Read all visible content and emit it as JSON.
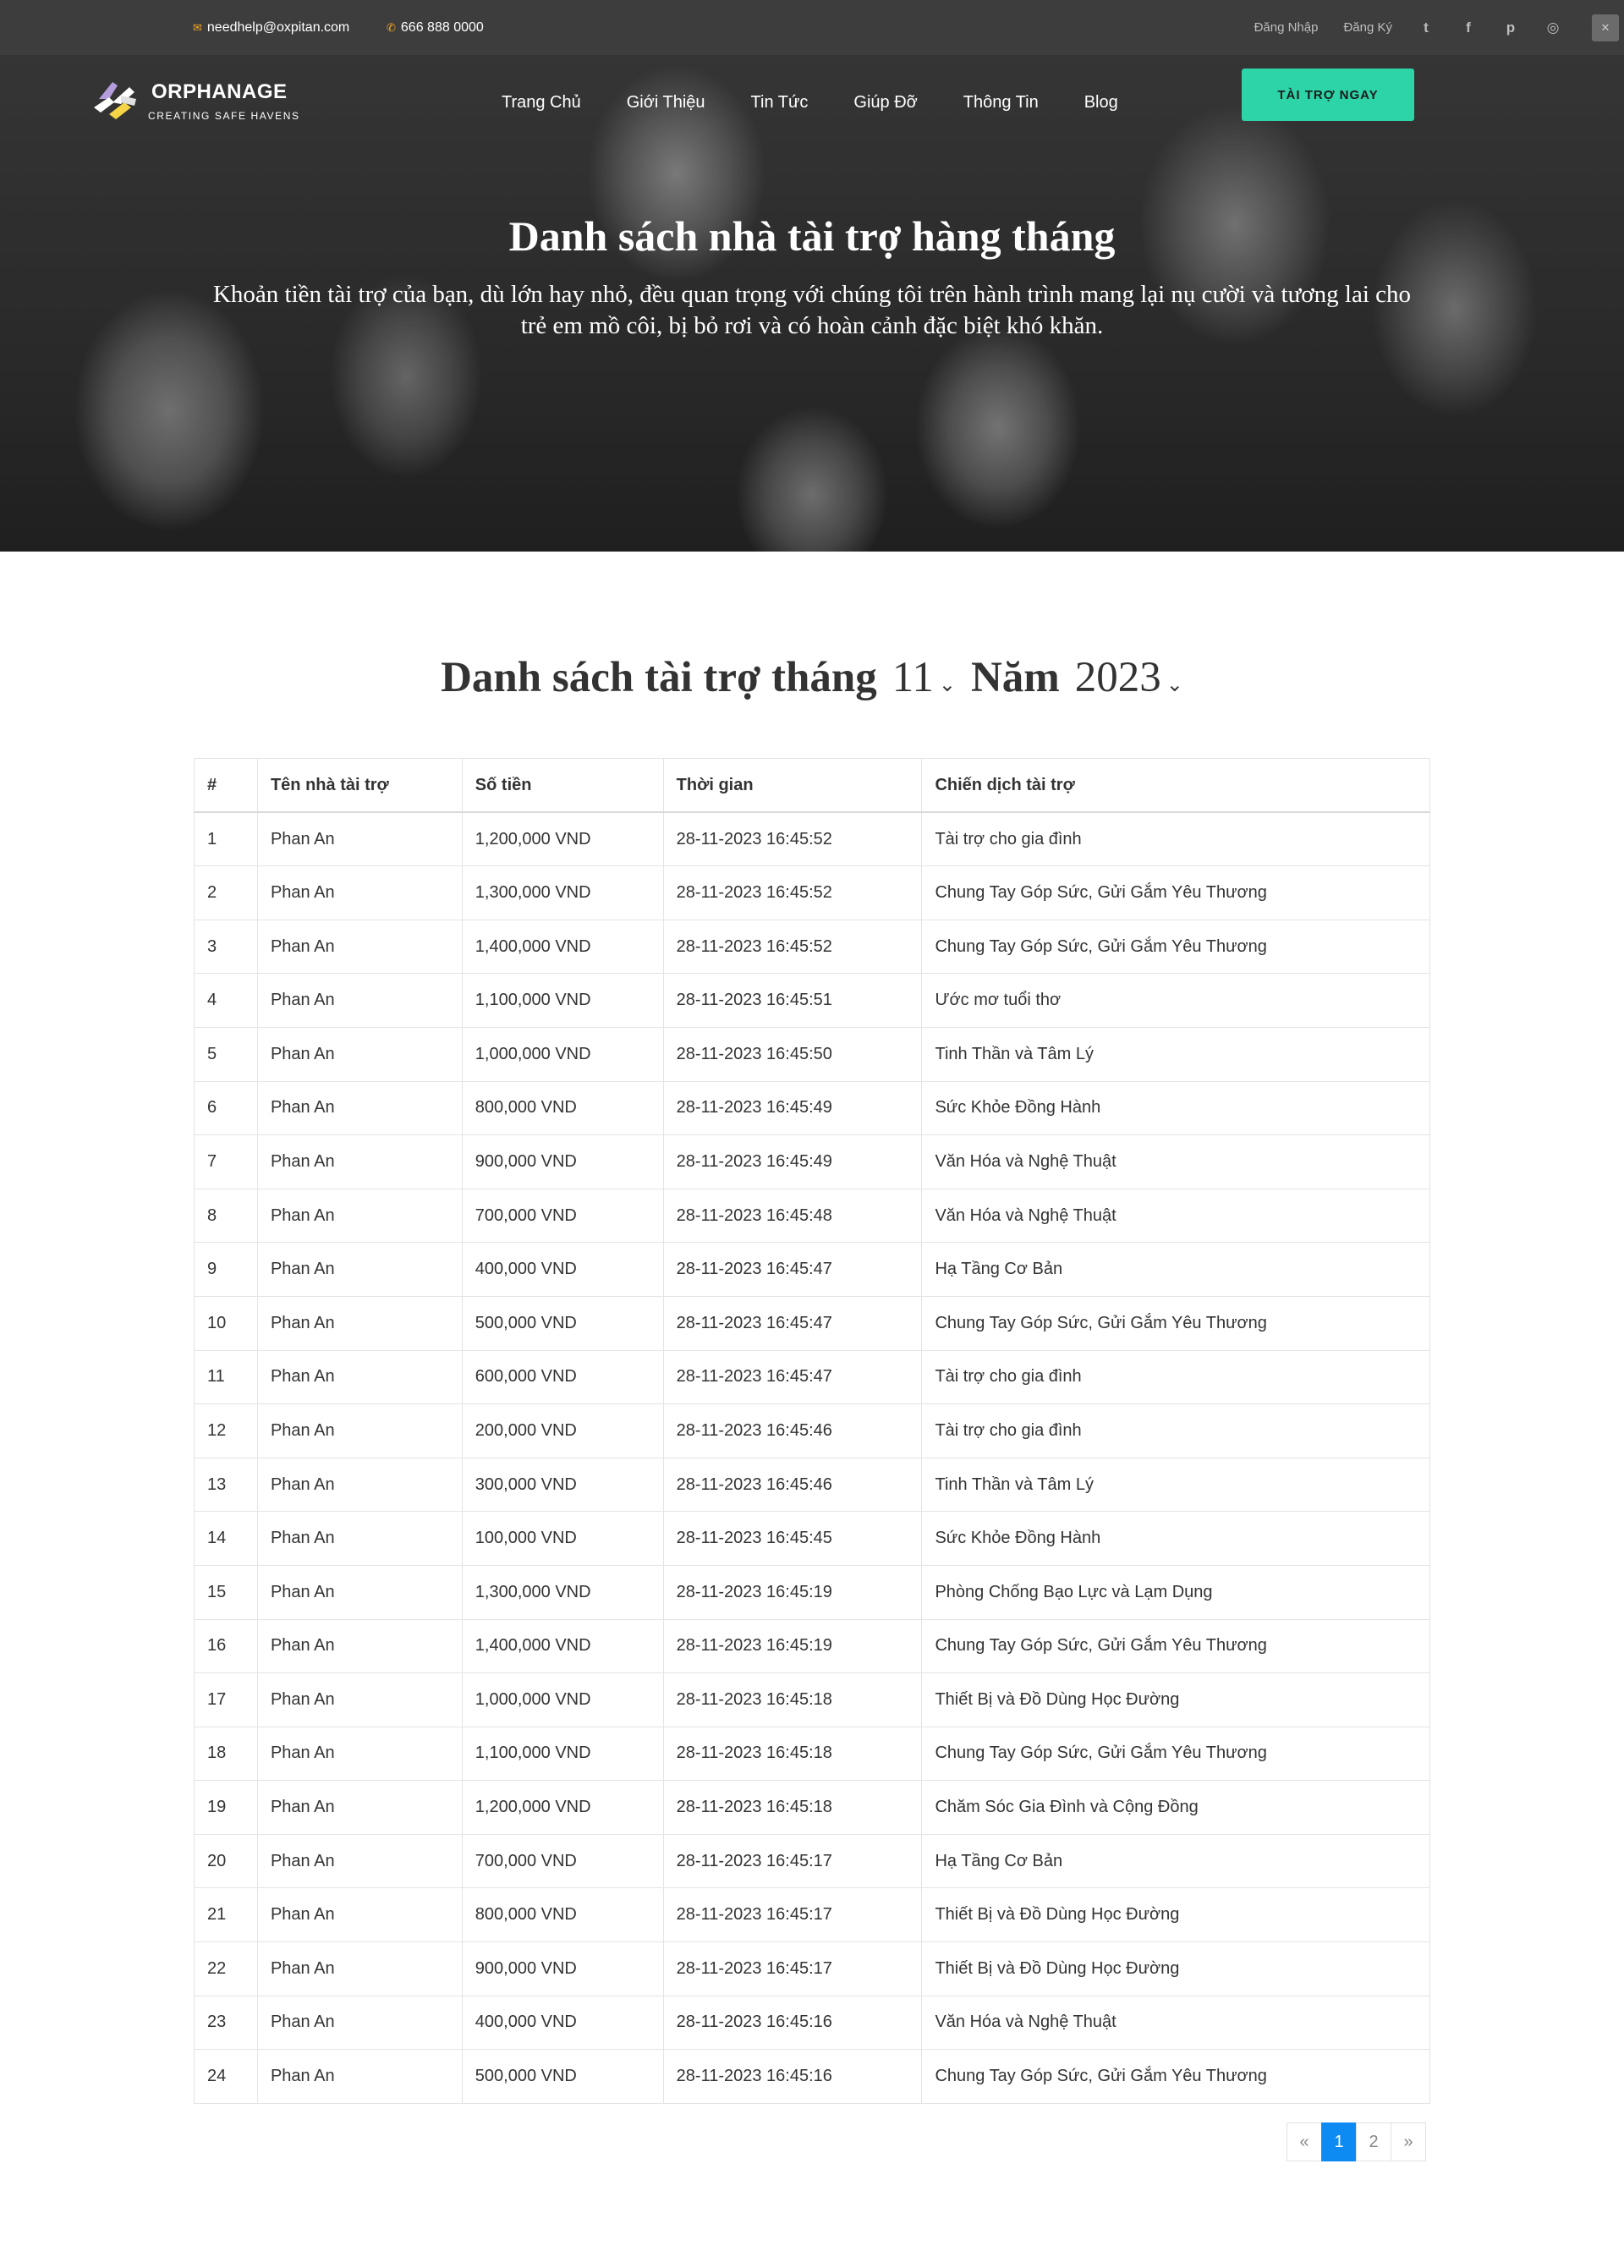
{
  "topbar": {
    "email": "needhelp@oxpitan.com",
    "phone": "666 888 0000",
    "login": "Đăng Nhập",
    "register": "Đăng Ký",
    "social": [
      {
        "name": "twitter-icon",
        "glyph": "t"
      },
      {
        "name": "facebook-icon",
        "glyph": "f"
      },
      {
        "name": "pinterest-icon",
        "glyph": "p"
      },
      {
        "name": "instagram-icon",
        "glyph": "◎"
      }
    ]
  },
  "brand": {
    "name": "ORPHANAGE",
    "tagline": "CREATING SAFE HAVENS"
  },
  "nav": {
    "items": [
      "Trang Chủ",
      "Giới Thiệu",
      "Tin Tức",
      "Giúp Đỡ",
      "Thông Tin",
      "Blog"
    ]
  },
  "cta": {
    "label": "TÀI TRỢ NGAY",
    "color": "#2dd4a8"
  },
  "hero": {
    "title": "Danh sách nhà tài trợ hàng tháng",
    "subtitle": "Khoản tiền tài trợ của bạn, dù lớn hay nhỏ, đều quan trọng với chúng tôi trên hành trình mang lại nụ cười và tương lai cho trẻ em mồ côi, bị bỏ rơi và có hoàn cảnh đặc biệt khó khăn."
  },
  "list": {
    "title_prefix": "Danh sách tài trợ tháng",
    "month": "11",
    "year_label": "Năm",
    "year": "2023"
  },
  "table": {
    "headers": [
      "#",
      "Tên nhà tài trợ",
      "Số tiền",
      "Thời gian",
      "Chiến dịch tài trợ"
    ],
    "rows": [
      [
        "1",
        "Phan An",
        "1,200,000 VND",
        "28-11-2023 16:45:52",
        "Tài trợ cho gia đình"
      ],
      [
        "2",
        "Phan An",
        "1,300,000 VND",
        "28-11-2023 16:45:52",
        "Chung Tay Góp Sức, Gửi Gắm Yêu Thương"
      ],
      [
        "3",
        "Phan An",
        "1,400,000 VND",
        "28-11-2023 16:45:52",
        "Chung Tay Góp Sức, Gửi Gắm Yêu Thương"
      ],
      [
        "4",
        "Phan An",
        "1,100,000 VND",
        "28-11-2023 16:45:51",
        "Ước mơ tuổi thơ"
      ],
      [
        "5",
        "Phan An",
        "1,000,000 VND",
        "28-11-2023 16:45:50",
        "Tinh Thần và Tâm Lý"
      ],
      [
        "6",
        "Phan An",
        "800,000 VND",
        "28-11-2023 16:45:49",
        "Sức Khỏe Đồng Hành"
      ],
      [
        "7",
        "Phan An",
        "900,000 VND",
        "28-11-2023 16:45:49",
        "Văn Hóa và Nghệ Thuật"
      ],
      [
        "8",
        "Phan An",
        "700,000 VND",
        "28-11-2023 16:45:48",
        "Văn Hóa và Nghệ Thuật"
      ],
      [
        "9",
        "Phan An",
        "400,000 VND",
        "28-11-2023 16:45:47",
        "Hạ Tầng Cơ Bản"
      ],
      [
        "10",
        "Phan An",
        "500,000 VND",
        "28-11-2023 16:45:47",
        "Chung Tay Góp Sức, Gửi Gắm Yêu Thương"
      ],
      [
        "11",
        "Phan An",
        "600,000 VND",
        "28-11-2023 16:45:47",
        "Tài trợ cho gia đình"
      ],
      [
        "12",
        "Phan An",
        "200,000 VND",
        "28-11-2023 16:45:46",
        "Tài trợ cho gia đình"
      ],
      [
        "13",
        "Phan An",
        "300,000 VND",
        "28-11-2023 16:45:46",
        "Tinh Thần và Tâm Lý"
      ],
      [
        "14",
        "Phan An",
        "100,000 VND",
        "28-11-2023 16:45:45",
        "Sức Khỏe Đồng Hành"
      ],
      [
        "15",
        "Phan An",
        "1,300,000 VND",
        "28-11-2023 16:45:19",
        "Phòng Chống Bạo Lực và Lạm Dụng"
      ],
      [
        "16",
        "Phan An",
        "1,400,000 VND",
        "28-11-2023 16:45:19",
        "Chung Tay Góp Sức, Gửi Gắm Yêu Thương"
      ],
      [
        "17",
        "Phan An",
        "1,000,000 VND",
        "28-11-2023 16:45:18",
        "Thiết Bị và Đồ Dùng Học Đường"
      ],
      [
        "18",
        "Phan An",
        "1,100,000 VND",
        "28-11-2023 16:45:18",
        "Chung Tay Góp Sức, Gửi Gắm Yêu Thương"
      ],
      [
        "19",
        "Phan An",
        "1,200,000 VND",
        "28-11-2023 16:45:18",
        "Chăm Sóc Gia Đình và Cộng Đồng"
      ],
      [
        "20",
        "Phan An",
        "700,000 VND",
        "28-11-2023 16:45:17",
        "Hạ Tầng Cơ Bản"
      ],
      [
        "21",
        "Phan An",
        "800,000 VND",
        "28-11-2023 16:45:17",
        "Thiết Bị và Đồ Dùng Học Đường"
      ],
      [
        "22",
        "Phan An",
        "900,000 VND",
        "28-11-2023 16:45:17",
        "Thiết Bị và Đồ Dùng Học Đường"
      ],
      [
        "23",
        "Phan An",
        "400,000 VND",
        "28-11-2023 16:45:16",
        "Văn Hóa và Nghệ Thuật"
      ],
      [
        "24",
        "Phan An",
        "500,000 VND",
        "28-11-2023 16:45:16",
        "Chung Tay Góp Sức, Gửi Gắm Yêu Thương"
      ]
    ]
  },
  "pagination": {
    "prev": "«",
    "pages": [
      "1",
      "2"
    ],
    "current": "1",
    "next": "»",
    "active_color": "#0d8bf2"
  }
}
